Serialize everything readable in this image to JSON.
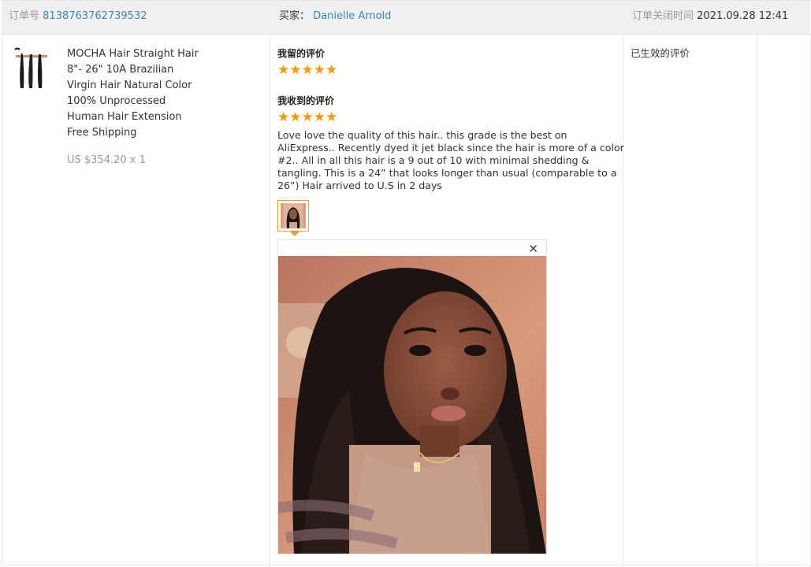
{
  "header": {
    "order_label": "订单号",
    "order_number": "8138763762739532",
    "buyer_label": "买家：",
    "buyer_name": "Danielle Arnold",
    "close_label": "订单关闭时间",
    "close_time": "2021.09.28 12:41"
  },
  "product": {
    "title_lines": [
      "MOCHA Hair Straight Hair",
      "8\"- 26\" 10A Brazilian",
      "Virgin Hair Natural Color",
      "100% Unprocessed",
      "Human Hair Extension",
      "Free Shipping"
    ],
    "price": "US $354.20 x 1"
  },
  "review": {
    "left_title": "我留的评价",
    "left_rating": 5,
    "received_title": "我收到的评价",
    "received_rating": 5,
    "text": "Love love the quality of this hair.. this grade is the best on AliExpress.. Recently dyed it jet black since the hair is more of a color #2.. All in all this hair is a 9 out of 10 with minimal shedding & tangling. This is a 24”  that looks longer than usual (comparable to a 26”) Hair arrived to U.S in 2 days",
    "close_glyph": "✕"
  },
  "status": {
    "text": "已生效的评价"
  },
  "colors": {
    "accent_link": "#3b86b8",
    "star": "#f59b00",
    "thumb_border": "#f0a020"
  },
  "icons": {
    "close": "close-icon",
    "star": "star-icon"
  }
}
